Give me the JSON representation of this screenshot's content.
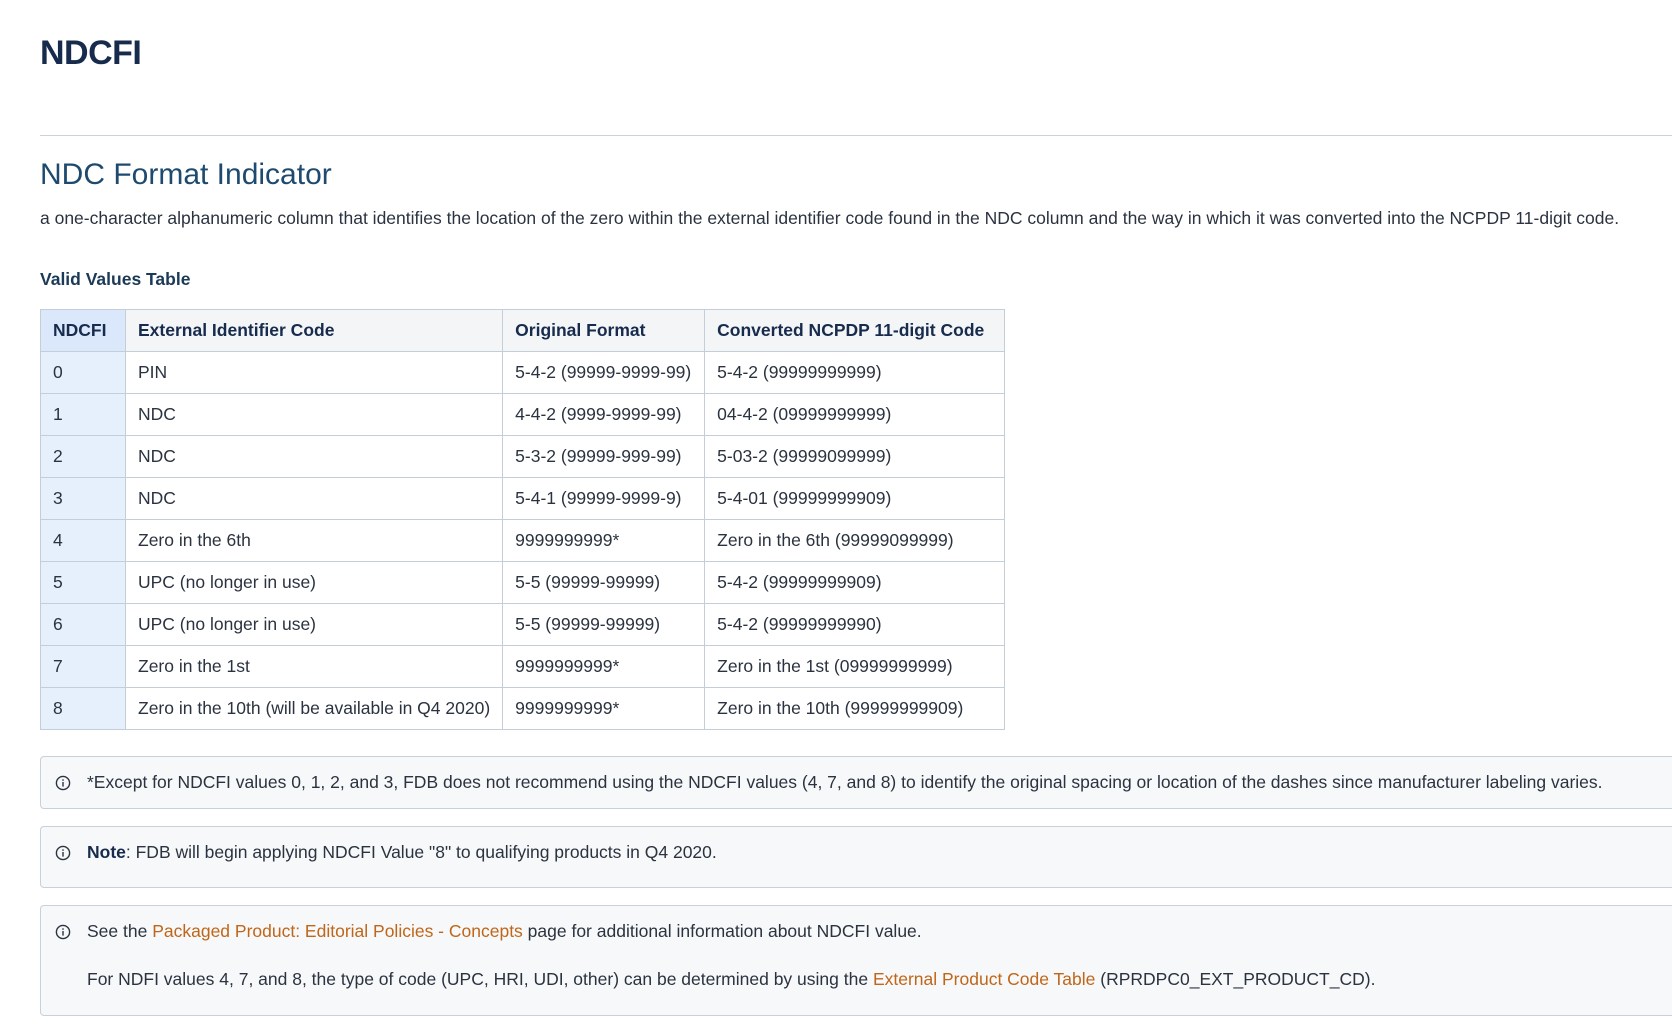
{
  "page": {
    "title": "NDCFI"
  },
  "section": {
    "title": "NDC Format Indicator",
    "description": "a one-character alphanumeric column that identifies the location of the zero within the external identifier code found in the NDC column and the way in which it was converted into the NCPDP 11-digit code."
  },
  "table": {
    "caption": "Valid Values Table",
    "headers": [
      "NDCFI",
      "External Identifier Code",
      "Original Format",
      "Converted NCPDP 11-digit Code"
    ],
    "rows": [
      [
        "0",
        "PIN",
        "5-4-2 (99999-9999-99)",
        "5-4-2 (99999999999)"
      ],
      [
        "1",
        "NDC",
        "4-4-2 (9999-9999-99)",
        "04-4-2 (09999999999)"
      ],
      [
        "2",
        "NDC",
        "5-3-2 (99999-999-99)",
        "5-03-2 (99999099999)"
      ],
      [
        "3",
        "NDC",
        "5-4-1 (99999-9999-9)",
        "5-4-01 (99999999909)"
      ],
      [
        "4",
        "Zero in the 6th",
        "9999999999*",
        "Zero in the 6th (99999099999)"
      ],
      [
        "5",
        "UPC (no longer in use)",
        "5-5 (99999-99999)",
        "5-4-2 (99999999909)"
      ],
      [
        "6",
        "UPC (no longer in use)",
        "5-5 (99999-99999)",
        "5-4-2 (99999999990)"
      ],
      [
        "7",
        "Zero in the 1st",
        "9999999999*",
        "Zero in the 1st (09999999999)"
      ],
      [
        "8",
        "Zero in the 10th (will be available in Q4 2020)",
        "9999999999*",
        "Zero in the 10th (99999999909)"
      ]
    ]
  },
  "notes": {
    "footnote": "*Except for NDCFI values 0, 1, 2, and 3, FDB does not recommend using the NDCFI values (4, 7, and 8) to identify the original spacing or location of the dashes since manufacturer labeling varies.",
    "note_label": "Note",
    "note_text": ": FDB will begin applying NDCFI Value \"8\" to qualifying products in Q4 2020.",
    "see_prefix": "See the ",
    "see_link": "Packaged Product: Editorial Policies - Concepts",
    "see_suffix": " page for additional information about NDCFI value.",
    "code_prefix": "For NDFI values 4, 7, and 8, the type of code (UPC, HRI, UDI, other) can be determined by using the ",
    "code_link": "External Product Code Table",
    "code_suffix": " (RPRDPC0_EXT_PRODUCT_CD)."
  },
  "icons": {
    "info": "info-circle-icon"
  },
  "colors": {
    "heading": "#172b4d",
    "section_heading": "#1d4a6e",
    "link": "#c0661a",
    "first_column": "#e6effc"
  }
}
